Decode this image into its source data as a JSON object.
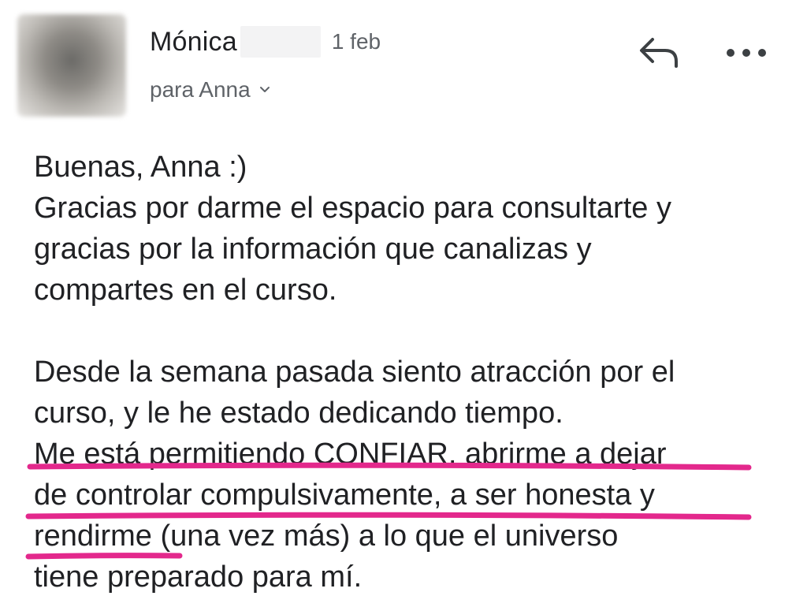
{
  "header": {
    "sender_name": "Mónica",
    "date": "1 feb",
    "recipient": "para Anna"
  },
  "icons": {
    "reply": "reply-icon",
    "more": "more-options-icon",
    "chevron": "chevron-down-icon"
  },
  "body": {
    "lines": [
      "Buenas, Anna :)",
      "Gracias por darme el espacio para consultarte y",
      "gracias por la información que canalizas y",
      "compartes en el curso.",
      "",
      "Desde la semana pasada siento atracción por el",
      "curso, y le he estado dedicando tiempo.",
      "Me está permitiendo CONFIAR, abrirme a dejar",
      "de controlar compulsivamente, a ser honesta y",
      "rendirme",
      " (una vez más) a lo que el universo",
      "tiene preparado para mí."
    ]
  },
  "colors": {
    "highlight_underline": "#e3288c",
    "text": "#202124",
    "secondary_text": "#5f6368"
  }
}
